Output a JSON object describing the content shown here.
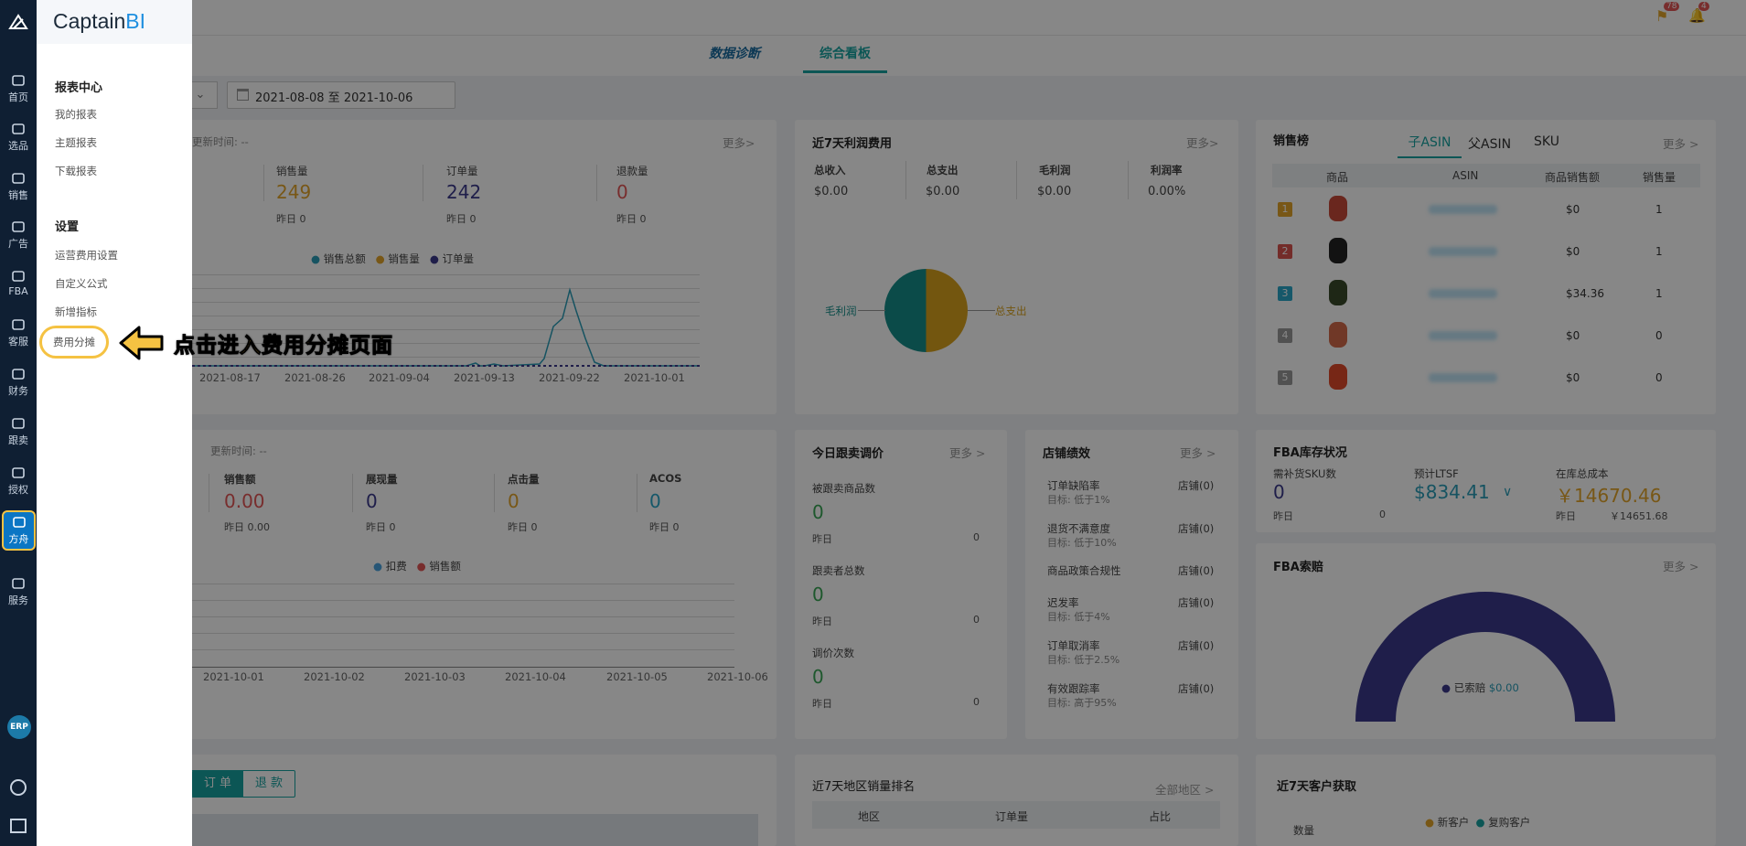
{
  "brand": {
    "name_part1": "Captain",
    "name_part2": "BI"
  },
  "rail": {
    "items": [
      {
        "label": "首页",
        "icon": "home-icon"
      },
      {
        "label": "选品",
        "icon": "search-icon"
      },
      {
        "label": "销售",
        "icon": "trend-chart-icon"
      },
      {
        "label": "广告",
        "icon": "ad-icon"
      },
      {
        "label": "FBA",
        "icon": "warehouse-icon"
      },
      {
        "label": "客服",
        "icon": "bar-chart-icon"
      },
      {
        "label": "财务",
        "icon": "finance-icon"
      },
      {
        "label": "跟卖",
        "icon": "pie-icon"
      },
      {
        "label": "授权",
        "icon": "shield-icon"
      },
      {
        "label": "方舟",
        "icon": "ark-icon"
      },
      {
        "label": "服务",
        "icon": "service-icon"
      }
    ],
    "erp": "ERP"
  },
  "menu": {
    "reports_heading": "报表中心",
    "reports": [
      "我的报表",
      "主题报表",
      "下载报表"
    ],
    "settings_heading": "设置",
    "settings": [
      "运营费用设置",
      "自定义公式",
      "新增指标",
      "费用分摊"
    ]
  },
  "annotation": "点击进入费用分摊页面",
  "header": {
    "flag_badge": "78",
    "bell_badge": "4"
  },
  "tabs": {
    "diagnosis": "数据诊断",
    "dashboard": "综合看板"
  },
  "filter": {
    "date_range": "2021-08-08 至 2021-10-06"
  },
  "sales_card": {
    "updated": "更新时间: --",
    "more": "更多>",
    "metrics": [
      {
        "label": "销售量",
        "value": "249",
        "yesterday": "昨日  0",
        "color": "#e3a52a"
      },
      {
        "label": "订单量",
        "value": "242",
        "yesterday": "昨日  0",
        "color": "#3b3a8c"
      },
      {
        "label": "退款量",
        "value": "0",
        "yesterday": "昨日  0",
        "color": "#e25555"
      }
    ],
    "legend": [
      "销售总额",
      "销售量",
      "订单量"
    ],
    "xticks": [
      "2021-08-17",
      "2021-08-26",
      "2021-09-04",
      "2021-09-13",
      "2021-09-22",
      "2021-10-01"
    ]
  },
  "profit_card": {
    "title": "近7天利润费用",
    "more": "更多>",
    "metrics": [
      {
        "label": "总收入",
        "value": "$0.00"
      },
      {
        "label": "总支出",
        "value": "$0.00"
      },
      {
        "label": "毛利润",
        "value": "$0.00"
      },
      {
        "label": "利润率",
        "value": "0.00%"
      }
    ],
    "pie_labels": [
      "毛利润",
      "总支出"
    ]
  },
  "ranking_card": {
    "title": "销售榜",
    "tabs": [
      "子ASIN",
      "父ASIN",
      "SKU"
    ],
    "more": "更多 >",
    "columns": [
      "商品",
      "ASIN",
      "商品销售额",
      "销售量"
    ],
    "rows": [
      {
        "rank": "1",
        "sales": "$0",
        "qty": "1",
        "rank_color": "#e3a52a",
        "thumb": "#c84a3a"
      },
      {
        "rank": "2",
        "sales": "$0",
        "qty": "1",
        "rank_color": "#d9534f",
        "thumb": "#222222"
      },
      {
        "rank": "3",
        "sales": "$34.36",
        "qty": "1",
        "rank_color": "#2aa7c9",
        "thumb": "#3a4a2a"
      },
      {
        "rank": "4",
        "sales": "$0",
        "qty": "0",
        "rank_color": "#999999",
        "thumb": "#d36a4a"
      },
      {
        "rank": "5",
        "sales": "$0",
        "qty": "0",
        "rank_color": "#999999",
        "thumb": "#e04a2a"
      }
    ]
  },
  "ad_card": {
    "updated": "更新时间: --",
    "metrics": [
      {
        "label": "销售额",
        "value": "0.00",
        "yesterday": "昨日  0.00",
        "color": "#e25555"
      },
      {
        "label": "展现量",
        "value": "0",
        "yesterday": "昨日  0",
        "color": "#3b3a8c"
      },
      {
        "label": "点击量",
        "value": "0",
        "yesterday": "昨日  0",
        "color": "#e3a52a"
      },
      {
        "label": "ACOS",
        "value": "0",
        "yesterday": "昨日  0",
        "color": "#2aa7c9"
      }
    ],
    "legend": [
      "扣费",
      "销售额"
    ],
    "xticks": [
      "2021-10-01",
      "2021-10-02",
      "2021-10-03",
      "2021-10-04",
      "2021-10-05",
      "2021-10-06"
    ]
  },
  "follow_card": {
    "title": "今日跟卖调价",
    "more": "更多 >",
    "items": [
      {
        "label": "被跟卖商品数",
        "value": "0",
        "yesterday_label": "昨日",
        "yesterday_value": "0"
      },
      {
        "label": "跟卖者总数",
        "value": "0",
        "yesterday_label": "昨日",
        "yesterday_value": "0"
      },
      {
        "label": "调价次数",
        "value": "0",
        "yesterday_label": "昨日",
        "yesterday_value": "0"
      }
    ]
  },
  "store_card": {
    "title": "店铺绩效",
    "more": "更多 >",
    "items": [
      {
        "label": "订单缺陷率",
        "target": "目标: 低于1%",
        "value": "店铺(0)"
      },
      {
        "label": "退货不满意度",
        "target": "目标: 低于10%",
        "value": "店铺(0)"
      },
      {
        "label": "商品政策合规性",
        "target": "",
        "value": "店铺(0)"
      },
      {
        "label": "迟发率",
        "target": "目标: 低于4%",
        "value": "店铺(0)"
      },
      {
        "label": "订单取消率",
        "target": "目标: 低于2.5%",
        "value": "店铺(0)"
      },
      {
        "label": "有效跟踪率",
        "target": "目标: 高于95%",
        "value": "店铺(0)"
      }
    ]
  },
  "fba_stock": {
    "title": "FBA库存状况",
    "restock_label": "需补货SKU数",
    "restock_value": "0",
    "restock_yesterday": "昨日",
    "restock_yesterday_value": "0",
    "ltsf_label": "预计LTSF",
    "ltsf_value": "$834.41",
    "cost_label": "在库总成本",
    "cost_value": "￥14670.46",
    "cost_yesterday": "昨日",
    "cost_yesterday_value": "￥14651.68"
  },
  "fba_claim": {
    "title": "FBA索赔",
    "more": "更多 >",
    "legend": "已索赔",
    "legend_value": "$0.00"
  },
  "order_tabs": [
    "订 单",
    "退 款"
  ],
  "region_card": {
    "title": "近7天地区销量排名",
    "more": "全部地区 >",
    "columns": [
      "地区",
      "订单量",
      "占比"
    ]
  },
  "customer_card": {
    "title": "近7天客户获取",
    "legend": [
      "新客户",
      "复购客户"
    ],
    "ylabel": "数量"
  }
}
